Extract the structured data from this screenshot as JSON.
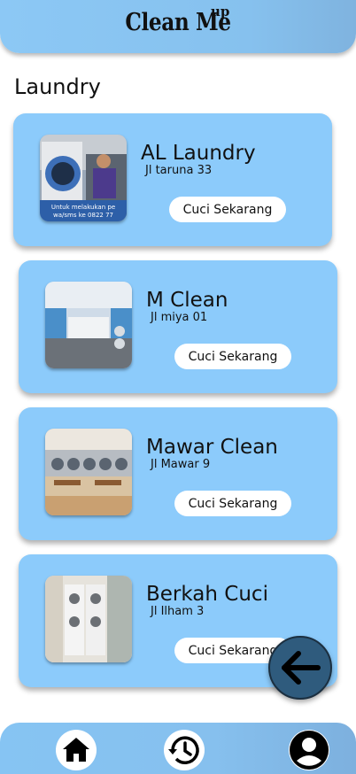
{
  "app": {
    "title": "Clean Me",
    "title_sup": "up"
  },
  "section": {
    "title": "Laundry"
  },
  "laundries": [
    {
      "name": "AL Laundry",
      "address": "Jl taruna 33",
      "cta": "Cuci Sekarang",
      "image_caption": "Untuk melakukan pe wa/sms ke 0822 77"
    },
    {
      "name": "M Clean",
      "address": "Jl miya 01",
      "cta": "Cuci Sekarang"
    },
    {
      "name": "Mawar Clean",
      "address": "Jl Mawar 9",
      "cta": "Cuci Sekarang"
    },
    {
      "name": "Berkah Cuci",
      "address": "Jl Ilham 3",
      "cta": "Cuci Sekarang"
    }
  ],
  "colors": {
    "header": "#8cc8f5",
    "card": "#8ccbfb",
    "fab": "#2f5b7d"
  },
  "icons": {
    "back": "arrow-left-icon",
    "home": "home-icon",
    "history": "history-icon",
    "profile": "user-icon"
  }
}
